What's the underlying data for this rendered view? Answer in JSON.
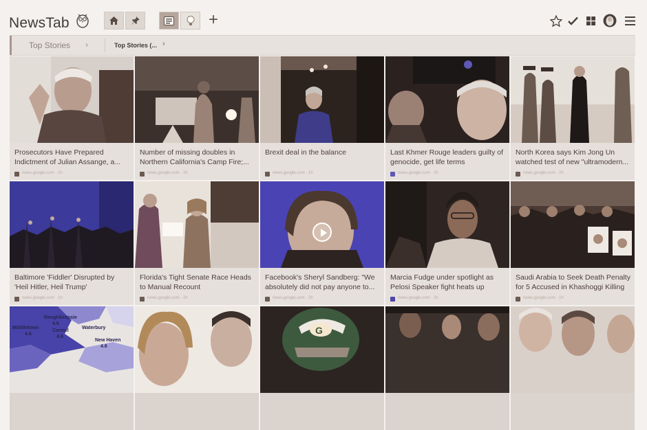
{
  "app": {
    "name": "NewsTab"
  },
  "header": {
    "buttons": [
      {
        "icon": "home-icon"
      },
      {
        "icon": "pin-icon"
      },
      {
        "icon": "news-list-icon"
      },
      {
        "icon": "lightbulb-icon"
      },
      {
        "icon": "plus-icon",
        "label": "+"
      }
    ],
    "right_icons": [
      "star-icon",
      "check-icon",
      "grid-icon",
      "profile-icon",
      "menu-icon"
    ]
  },
  "breadcrumb": {
    "first": "Top Stories",
    "second": "Top Stories (..."
  },
  "cards": [
    {
      "title": "Prosecutors Have Prepared Indictment of Julian Assange, a...",
      "source": "news.google.com · 1h",
      "image": "man-face-portrait"
    },
    {
      "title": "Number of missing doubles in Northern California's Camp Fire;...",
      "source": "news.google.com · 2h",
      "image": "firefighters-night"
    },
    {
      "title": "Brexit deal in the balance",
      "source": "news.google.com · 1h",
      "image": "woman-blue-doorway"
    },
    {
      "title": "Last Khmer Rouge leaders guilty of genocide, get life terms",
      "source": "news.google.com · 2h",
      "image": "elderly-men-court"
    },
    {
      "title": "North Korea says Kim Jong Un watched test of new \"ultramodern...",
      "source": "news.google.com · 2h",
      "image": "officials-field"
    },
    {
      "title": "Baltimore 'Fiddler' Disrupted by 'Heil Hitler, Heil Trump'",
      "source": "news.google.com · 1h",
      "image": "audience-stage"
    },
    {
      "title": "Florida's Tight Senate Race Heads to Manual Recount",
      "source": "news.google.com · 2h",
      "image": "women-counting"
    },
    {
      "title": "Facebook's Sheryl Sandberg: \"We absolutely did not pay anyone to...",
      "source": "news.google.com · 2h",
      "image": "woman-smiling-video"
    },
    {
      "title": "Marcia Fudge under spotlight as Pelosi Speaker fight heats up",
      "source": "news.google.com · 2h",
      "image": "woman-glasses"
    },
    {
      "title": "Saudi Arabia to Seek Death Penalty for 5 Accused in Khashoggi Killing",
      "source": "news.google.com · 1h",
      "image": "protest-crowd"
    },
    {
      "title": "",
      "source": "",
      "image": "weather-map"
    },
    {
      "title": "",
      "source": "",
      "image": "two-people"
    },
    {
      "title": "",
      "source": "",
      "image": "football-helmet"
    },
    {
      "title": "",
      "source": "",
      "image": "group-photo"
    },
    {
      "title": "",
      "source": "",
      "image": "men-closeup"
    }
  ],
  "map_labels": [
    "Roughkeepsie",
    "Middletown",
    "Waterbury",
    "Carmel",
    "New Haven",
    "4.6",
    "4.6",
    "4.6",
    "4.6"
  ]
}
